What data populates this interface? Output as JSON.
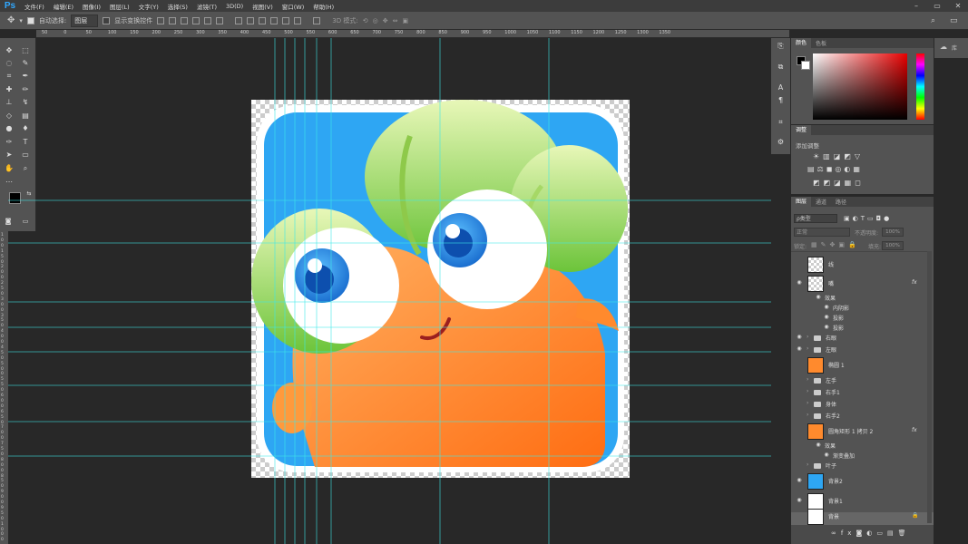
{
  "app": {
    "logo": "Ps"
  },
  "menu": [
    "文件(F)",
    "编辑(E)",
    "图像(I)",
    "图层(L)",
    "文字(Y)",
    "选择(S)",
    "滤镜(T)",
    "3D(D)",
    "视图(V)",
    "窗口(W)",
    "帮助(H)"
  ],
  "window_controls": [
    "–",
    "▭",
    "✕"
  ],
  "options": {
    "auto_select_label": "自动选择:",
    "auto_select_value": "图层",
    "transform_label": "显示变换控件",
    "mode_3d_label": "3D 模式:"
  },
  "ruler_top": [
    "50",
    "0",
    "50",
    "100",
    "150",
    "200",
    "250",
    "300",
    "350",
    "400",
    "450",
    "500",
    "550",
    "600",
    "650",
    "700",
    "750",
    "800",
    "850",
    "900",
    "950",
    "1000",
    "1050",
    "1100",
    "1150",
    "1200",
    "1250",
    "1300",
    "1350"
  ],
  "ruler_left": [
    "1",
    "0",
    "0",
    "1",
    "5",
    "0",
    "2",
    "0",
    "0",
    "2",
    "5",
    "0",
    "3",
    "0",
    "0",
    "3",
    "5",
    "0",
    "4",
    "0",
    "0",
    "4",
    "5",
    "0",
    "5",
    "0",
    "0",
    "5",
    "5",
    "0",
    "6",
    "0",
    "0",
    "6",
    "5",
    "0",
    "7",
    "0",
    "0",
    "7",
    "5",
    "0",
    "8",
    "0",
    "0",
    "8",
    "5",
    "0",
    "9",
    "0",
    "0",
    "9",
    "5",
    "0",
    "1",
    "0",
    "0",
    "0"
  ],
  "panels": {
    "color_tabs": [
      "颜色",
      "色板"
    ],
    "library_tab": "库",
    "adjust_tab": "调整",
    "adjust_add_label": "添加调整",
    "layers_tabs": [
      "图层",
      "通道",
      "路径"
    ],
    "kind_label": "ρ类型",
    "blend_mode": "正常",
    "opacity_label": "不透明度:",
    "opacity_value": "100%",
    "lock_label": "锁定:",
    "fill_label": "填充:",
    "fill_value": "100%"
  },
  "layers": [
    {
      "name": "线",
      "type": "layer",
      "visible": false,
      "thumb": "checker"
    },
    {
      "name": "嘴",
      "type": "layer",
      "visible": true,
      "thumb": "checker",
      "fx": "fx"
    },
    {
      "name": "效果",
      "type": "effect"
    },
    {
      "name": "内阴影",
      "type": "effect-item"
    },
    {
      "name": "投影",
      "type": "effect-item"
    },
    {
      "name": "投影",
      "type": "effect-item"
    },
    {
      "name": "右眼",
      "type": "group",
      "visible": true
    },
    {
      "name": "左眼",
      "type": "group",
      "visible": true
    },
    {
      "name": "椭圆 1",
      "type": "layer",
      "visible": false,
      "thumb": "carrot"
    },
    {
      "name": "左手",
      "type": "group",
      "visible": false
    },
    {
      "name": "右手1",
      "type": "group",
      "visible": false
    },
    {
      "name": "身体",
      "type": "group",
      "visible": false
    },
    {
      "name": "右手2",
      "type": "group",
      "visible": false
    },
    {
      "name": "圆角矩形 1 拷贝 2",
      "type": "layer",
      "visible": false,
      "thumb": "carrot",
      "fx": "fx"
    },
    {
      "name": "效果",
      "type": "effect"
    },
    {
      "name": "渐变叠加",
      "type": "effect-item"
    },
    {
      "name": "叶子",
      "type": "group",
      "visible": false
    },
    {
      "name": "背景2",
      "type": "layer",
      "visible": true,
      "thumb": "blue"
    },
    {
      "name": "背景1",
      "type": "layer",
      "visible": true,
      "thumb": "white"
    },
    {
      "name": "背景",
      "type": "layer",
      "visible": false,
      "thumb": "white",
      "locked": true
    }
  ],
  "colors": {
    "foreground": "#000000",
    "background": "#ffffff",
    "icon_bg": "#2ea6f3",
    "carrot": "#ff8a2d",
    "leaf": "#8fd14f",
    "guide": "#3ee8e8"
  }
}
